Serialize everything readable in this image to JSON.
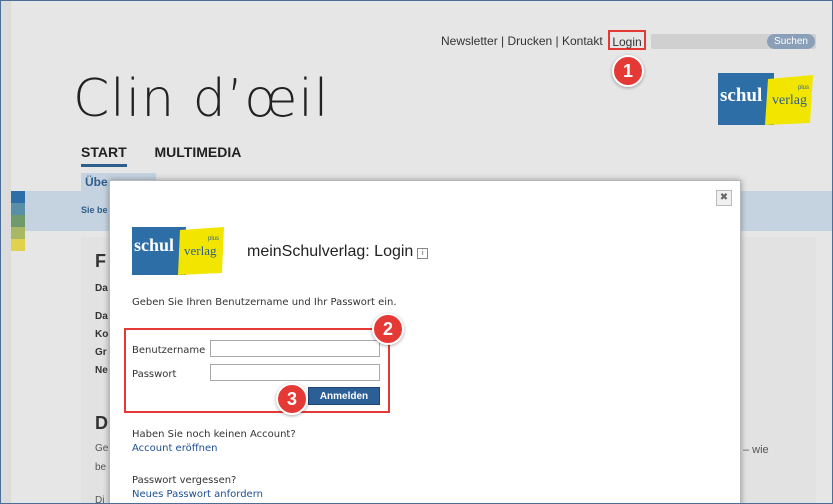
{
  "top_nav": {
    "newsletter": "Newsletter",
    "sep1": "|",
    "drucken": "Drucken",
    "sep2": "|",
    "kontakt": "Kontakt",
    "sep3": "|",
    "login": "Login",
    "search_button": "Suchen"
  },
  "brand": {
    "title": "Clin d’œil",
    "logo_text_schul": "schul",
    "logo_text_verlag": "verlag",
    "logo_text_plus": "plus"
  },
  "tabs": [
    "START",
    "MULTIMEDIA"
  ],
  "subtab": "Übe",
  "breadcrumb": "Sie be",
  "content": {
    "heading": "F",
    "lines": [
      "Da",
      "Da",
      "Ko",
      "Gr",
      "Ne"
    ],
    "heading2": "D",
    "para1": "Ge",
    "para2": "be",
    "para3": "Di",
    "trailing": "– wie"
  },
  "modal": {
    "logo_text_schul": "schul",
    "logo_text_verlag": "verlag",
    "logo_text_plus": "plus",
    "title": "meinSchulverlag: Login",
    "info_icon": "i",
    "close": "✖",
    "instruction": "Geben Sie Ihren Benutzername und Ihr Passwort ein.",
    "username_label": "Benutzername",
    "password_label": "Passwort",
    "username_value": "",
    "password_value": "",
    "submit": "Anmelden",
    "no_account_text": "Haben Sie noch keinen Account?",
    "create_account_link": "Account eröffnen",
    "forgot_text": "Passwort vergessen?",
    "reset_link": "Neues Passwort anfordern"
  },
  "badges": [
    "1",
    "2",
    "3"
  ],
  "colors": {
    "accent_red": "#e53935",
    "button_blue": "#2c5f96",
    "logo_blue": "#2e6ea6",
    "logo_yellow": "#f2e600"
  }
}
